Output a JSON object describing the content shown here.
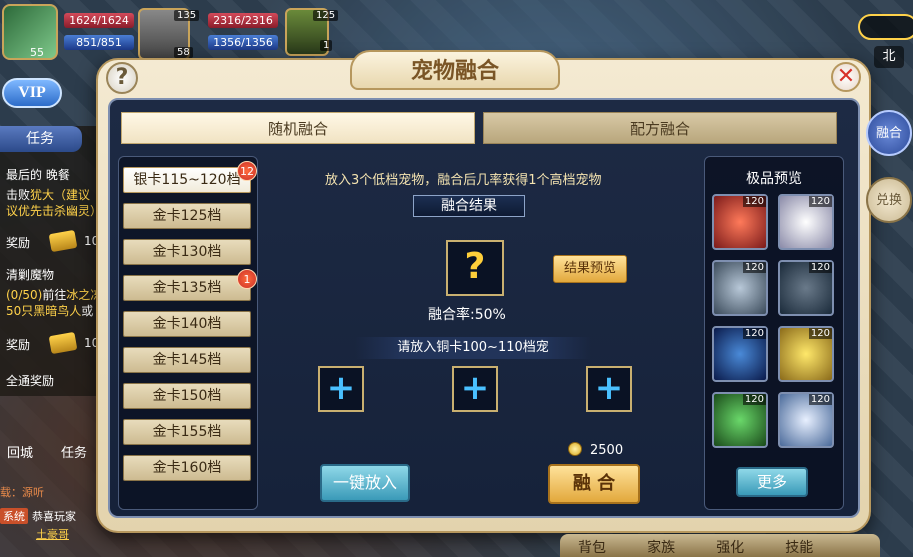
{
  "hud": {
    "player_hp": "1624/1624",
    "player_mp": "851/851",
    "player_level": "55",
    "pet_level": "135",
    "pet_level2": "58",
    "pet_hp": "2316/2316",
    "pet_mp": "1356/1356",
    "item_level": "125",
    "item_count": "1",
    "vip_label": "VIP",
    "compass_label": "北"
  },
  "left_panel": {
    "quest_tab": "任务",
    "quest1_title": "最后的 晚餐",
    "quest1_line1_a": "击败",
    "quest1_line1_b": "犹大",
    "quest1_line1_c": "（建议",
    "quest1_line2": "议优先击杀幽灵）",
    "reward_label": "奖励",
    "reward_value": "10",
    "quest2_title": "清剿魔物",
    "quest2_line1_a": "(0/50)",
    "quest2_line1_b": "前往",
    "quest2_line1_c": "冰之冻",
    "quest2_line2_a": "50只",
    "quest2_line2_b": "黑暗鸟人",
    "quest2_line2_c": "或",
    "reward2_label": "奖励",
    "reward2_value": "10",
    "all_reward": "全通奖励",
    "nav_city": "回城",
    "nav_task": "任务",
    "chat1_tag": "系统",
    "chat1_text": "恭喜玩家",
    "chat1_name": "土豪哥",
    "chat0": "载：源听"
  },
  "modal": {
    "title": "宠物融合",
    "help_icon": "?",
    "close_icon": "✕",
    "tabs": [
      {
        "label": "随机融合"
      },
      {
        "label": "配方融合"
      }
    ],
    "tiers": [
      {
        "label": "银卡115~120档",
        "badge": "12"
      },
      {
        "label": "金卡125档",
        "badge": ""
      },
      {
        "label": "金卡130档",
        "badge": ""
      },
      {
        "label": "金卡135档",
        "badge": "1"
      },
      {
        "label": "金卡140档",
        "badge": ""
      },
      {
        "label": "金卡145档",
        "badge": ""
      },
      {
        "label": "金卡150档",
        "badge": ""
      },
      {
        "label": "金卡155档",
        "badge": ""
      },
      {
        "label": "金卡160档",
        "badge": ""
      }
    ],
    "instruction": "放入3个低档宠物，融合后几率获得1个高档宠物",
    "result_title": "融合结果",
    "result_placeholder": "?",
    "preview_button": "结果预览",
    "rate_text": "融合率:50%",
    "put_title": "请放入铜卡100~110档宠",
    "add_symbol": "+",
    "cost": "2500",
    "onekey_button": "一键放入",
    "fuse_button": "融 合",
    "preview_panel_title": "极品预览",
    "preview_pets": [
      {
        "level": "120",
        "color": "#c9302a"
      },
      {
        "level": "120",
        "color": "#e8e8f0"
      },
      {
        "level": "120",
        "color": "#6a7a8a"
      },
      {
        "level": "120",
        "color": "#3a4a5a"
      },
      {
        "level": "120",
        "color": "#2a4a8a"
      },
      {
        "level": "120",
        "color": "#e8c83a"
      },
      {
        "level": "120",
        "color": "#3a8a3a"
      },
      {
        "level": "120",
        "color": "#c8d8e8"
      }
    ],
    "more_button": "更多"
  },
  "side_tabs": {
    "fuse": "融合",
    "exchange": "兑换"
  },
  "bottom": {
    "items": [
      "背包",
      "家族",
      "强化",
      "技能"
    ]
  }
}
